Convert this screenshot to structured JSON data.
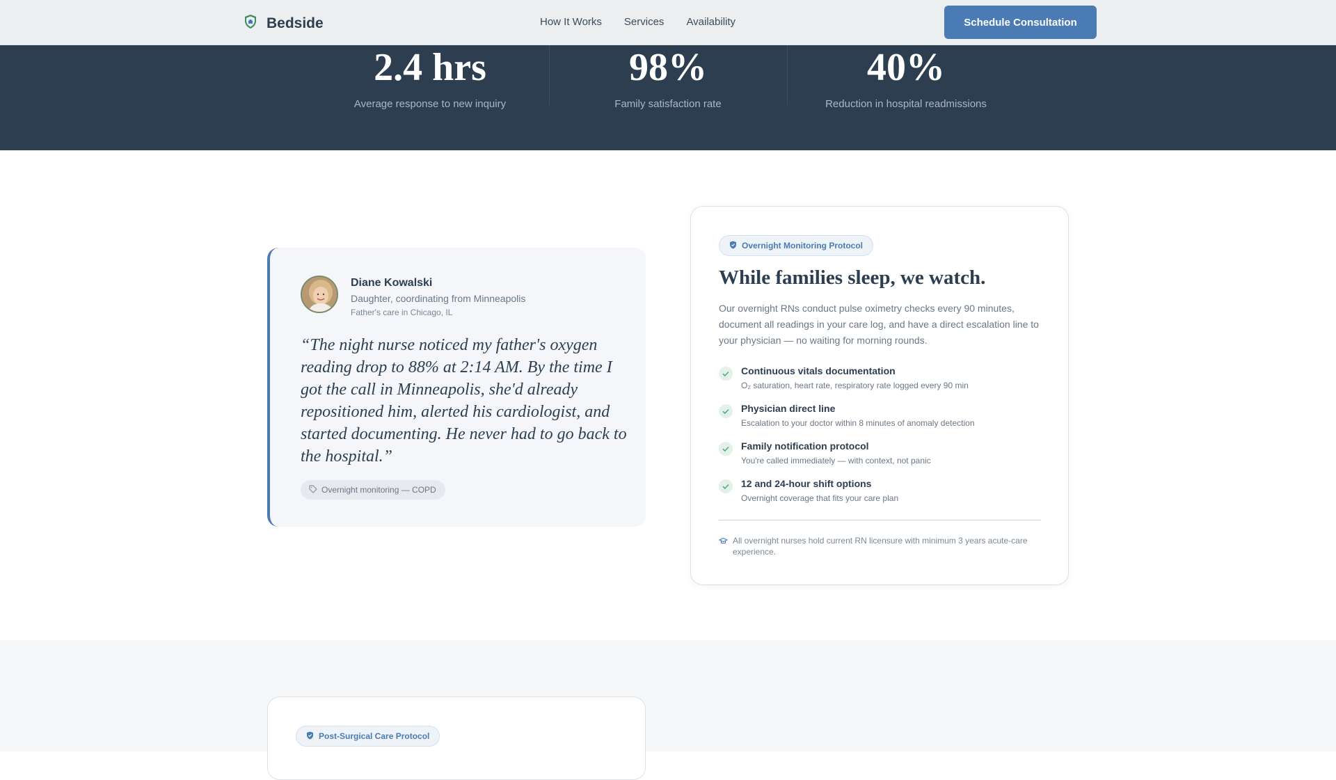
{
  "header": {
    "brand": "Bedside",
    "nav": [
      "How It Works",
      "Services",
      "Availability"
    ],
    "cta": "Schedule Consultation"
  },
  "stats": [
    {
      "value": "2.4 hrs",
      "label": "Average response to new inquiry"
    },
    {
      "value": "98%",
      "label": "Family satisfaction rate"
    },
    {
      "value": "40%",
      "label": "Reduction in hospital readmissions"
    }
  ],
  "testimonial": {
    "name": "Diane Kowalski",
    "role": "Daughter, coordinating from Minneapolis",
    "care": "Father's care in Chicago, IL",
    "quote": "“The night nurse noticed my father's oxygen reading drop to 88% at 2:14 AM. By the time I got the call in Minneapolis, she'd already repositioned him, alerted his cardiologist, and started documenting. He never had to go back to the hospital.”",
    "tag": "Overnight monitoring — COPD"
  },
  "protocol": {
    "badge": "Overnight Monitoring Protocol",
    "title": "While families sleep, we watch.",
    "description": "Our overnight RNs conduct pulse oximetry checks every 90 minutes, document all readings in your care log, and have a direct escalation line to your physician — no waiting for morning rounds.",
    "features": [
      {
        "title": "Continuous vitals documentation",
        "sub": "O₂ saturation, heart rate, respiratory rate logged every 90 min"
      },
      {
        "title": "Physician direct line",
        "sub": "Escalation to your doctor within 8 minutes of anomaly detection"
      },
      {
        "title": "Family notification protocol",
        "sub": "You're called immediately — with context, not panic"
      },
      {
        "title": "12 and 24-hour shift options",
        "sub": "Overnight coverage that fits your care plan"
      }
    ],
    "note": "All overnight nurses hold current RN licensure with minimum 3 years acute-care experience."
  },
  "next_section": {
    "badge": "Post-Surgical Care Protocol"
  },
  "colors": {
    "accent": "#4a7bb5",
    "dark": "#2c3e50",
    "check": "#4caf7a"
  }
}
